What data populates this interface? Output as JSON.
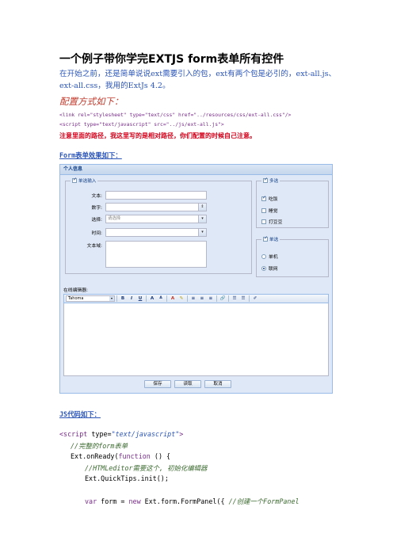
{
  "doc": {
    "title": "一个例子带你学完EXTJS form表单所有控件",
    "intro": "在开始之前，还是简单说说ext需要引入的包，ext有两个包是必引的，ext-all.js、ext-all.css，我用的ExtJs 4.2。",
    "config_heading": "配置方式如下：",
    "config_code": [
      "<link rel=\"stylesheet\" type=\"text/css\" href=\"../resources/css/ext-all.css\"/>",
      "<script type=\"text/javascript\" src=\"../js/ext-all.js\">"
    ],
    "note": "注意里面的路径，我这里写的是相对路径，你们配置的时候自己注意。",
    "form_heading": "Form表单效果如下：",
    "js_heading": "JS代码如下：",
    "js_code": [
      {
        "indent": 0,
        "parts": [
          [
            "kw",
            "<"
          ],
          [
            "kw",
            "script"
          ],
          [
            "",
            " type="
          ],
          [
            "str",
            "\"text/javascript\""
          ],
          [
            "kw",
            ">"
          ]
        ]
      },
      {
        "indent": 1,
        "parts": [
          [
            "cm",
            "//完整的form表单"
          ]
        ]
      },
      {
        "indent": 1,
        "parts": [
          [
            "",
            "Ext.onReady("
          ],
          [
            "kw",
            "function"
          ],
          [
            "",
            " () {"
          ]
        ]
      },
      {
        "indent": 2,
        "parts": [
          [
            "cm",
            "//HTMLeditor需要这个, 初始化编辑器"
          ]
        ]
      },
      {
        "indent": 2,
        "parts": [
          [
            "",
            "Ext.QuickTips.init();"
          ]
        ]
      },
      {
        "indent": 2,
        "parts": [
          [
            "",
            ""
          ]
        ]
      },
      {
        "indent": 2,
        "parts": [
          [
            "kw",
            "var"
          ],
          [
            "",
            " form = "
          ],
          [
            "kw",
            "new"
          ],
          [
            "",
            " Ext.form.FormPanel({ "
          ],
          [
            "cm",
            "//创建一个FormPanel"
          ]
        ]
      }
    ]
  },
  "form": {
    "panel_title": "个人信息",
    "single_fieldset": "单选输入",
    "labels": {
      "text": "文本:",
      "number": "数字:",
      "select": "选择:",
      "time": "时间:",
      "textarea": "文本域:"
    },
    "select_placeholder": "请选择",
    "checkbox_group": {
      "legend": "多选",
      "items": [
        {
          "label": "吃饭",
          "checked": true
        },
        {
          "label": "睡觉",
          "checked": false
        },
        {
          "label": "打豆豆",
          "checked": false
        }
      ]
    },
    "radio_group": {
      "legend": "单选",
      "items": [
        {
          "label": "单机",
          "checked": false
        },
        {
          "label": "联网",
          "checked": true
        }
      ]
    },
    "editor_label": "在线编辑器:",
    "editor_font": "Tahoma",
    "toolbar_buttons": [
      "B",
      "I",
      "U",
      "A",
      "A",
      "A",
      "✎",
      "≡",
      "≡",
      "≡",
      "🔗",
      "☰",
      "☰",
      "✐"
    ],
    "buttons": [
      "保存",
      "读取",
      "取消"
    ]
  }
}
